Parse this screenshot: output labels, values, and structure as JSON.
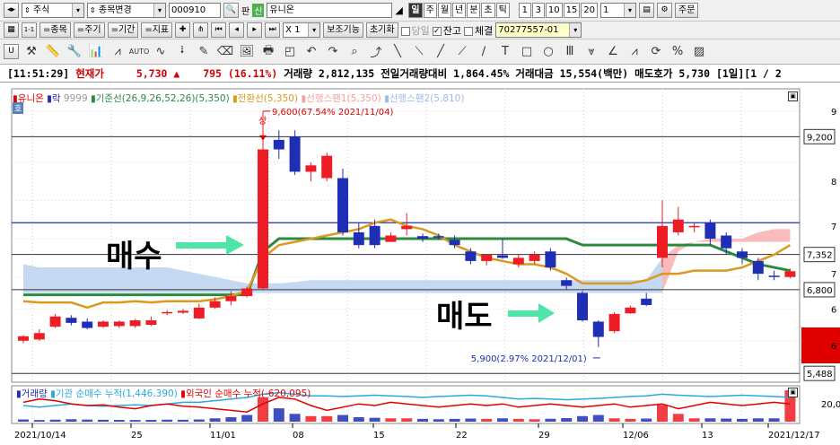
{
  "toolbar1": {
    "market": "주식",
    "change_label": "종목변경",
    "code": "000910",
    "pan": "판",
    "sin": "신",
    "name": "유니온",
    "periods": [
      "일",
      "주",
      "월",
      "년",
      "분",
      "초",
      "틱"
    ],
    "intervals": [
      "1",
      "3",
      "10",
      "15",
      "20"
    ],
    "interval_value": "1",
    "order_label": "주문"
  },
  "toolbar2": {
    "item_btn": "=종목",
    "cycle_btn": "=주기",
    "period_btn": "=기간",
    "indicator_btn": "=지표",
    "zoom": "X 1",
    "aux_btn": "보조기능",
    "reset_btn": "초기화",
    "today": "당일",
    "balance": "잔고",
    "trade": "체결",
    "account": "70277557-01"
  },
  "status": {
    "time": "[11:51:29]",
    "label": "현재가",
    "price": "5,730",
    "arrow": "▲",
    "change": "795",
    "change_pct": "(16.11%)",
    "volume_text": "거래량 2,812,135",
    "ratio_text": "전일거래량대비 1,864.45%",
    "amount_text": "거래대금 15,554(백만)",
    "ask_text": "매도호가 5,730",
    "page_text": "[1일][1 / 2"
  },
  "colors": {
    "up": "#ee1c25",
    "down": "#1f2fb5",
    "base": "#2b8a3e",
    "conv": "#d99a1e",
    "cloud": "#bcd2f0",
    "cloud_red": "#f8b4b4"
  },
  "main_legend": {
    "hoga": "호",
    "name": "유니온",
    "rak": "락",
    "rak2": "9999",
    "base_line": "기준선(26,9,26,52,26)(5,350)",
    "conv_line": "전환선(5,350)",
    "span1": "선행스팬1(5,350)",
    "span2": "선행스팬2(5,810)"
  },
  "annotations": {
    "high": "9,600(67.54% 2021/11/04)",
    "low": "5,900(2.97% 2021/12/01)",
    "sang": "상",
    "buy": "매수",
    "sell": "매도"
  },
  "y_labels": {
    "p9200": "9,200",
    "p7352": "7,352",
    "p6800": "6,800",
    "p5488": "5,488"
  },
  "y_ticks": [
    "9",
    "8",
    "7",
    "7",
    "6",
    "6"
  ],
  "sub_legend": {
    "vol": "거래량",
    "inst": "기관 순매수 누적(1,446,390)",
    "foreign": "외국인 순매수 누적(-620,095)",
    "right_label": "20,0"
  },
  "x_labels": [
    "2021/10/14",
    "25",
    "11/01",
    "08",
    "15",
    "22",
    "29",
    "12/06",
    "13",
    "2021/12/17"
  ],
  "chart_data": {
    "type": "candlestick",
    "price_ylim": [
      5350,
      9950
    ],
    "candles": [
      {
        "o": 6000,
        "h": 6090,
        "l": 5960,
        "c": 6070
      },
      {
        "o": 6020,
        "h": 6180,
        "l": 6000,
        "c": 6120
      },
      {
        "o": 6220,
        "h": 6420,
        "l": 6200,
        "c": 6380
      },
      {
        "o": 6360,
        "h": 6400,
        "l": 6240,
        "c": 6280
      },
      {
        "o": 6300,
        "h": 6350,
        "l": 6180,
        "c": 6200
      },
      {
        "o": 6220,
        "h": 6320,
        "l": 6200,
        "c": 6300
      },
      {
        "o": 6230,
        "h": 6320,
        "l": 6200,
        "c": 6300
      },
      {
        "o": 6230,
        "h": 6340,
        "l": 6200,
        "c": 6320
      },
      {
        "o": 6250,
        "h": 6380,
        "l": 6230,
        "c": 6320
      },
      {
        "o": 6430,
        "h": 6480,
        "l": 6400,
        "c": 6450
      },
      {
        "o": 6440,
        "h": 6500,
        "l": 6420,
        "c": 6470
      },
      {
        "o": 6350,
        "h": 6580,
        "l": 6340,
        "c": 6520
      },
      {
        "o": 6520,
        "h": 6680,
        "l": 6500,
        "c": 6620
      },
      {
        "o": 6620,
        "h": 6780,
        "l": 6560,
        "c": 6700
      },
      {
        "o": 6700,
        "h": 6850,
        "l": 6680,
        "c": 6820
      },
      {
        "o": 6820,
        "h": 9600,
        "l": 6800,
        "c": 9000
      },
      {
        "o": 9150,
        "h": 9300,
        "l": 8850,
        "c": 9000
      },
      {
        "o": 9200,
        "h": 9300,
        "l": 8600,
        "c": 8650
      },
      {
        "o": 8650,
        "h": 8800,
        "l": 8500,
        "c": 8750
      },
      {
        "o": 8550,
        "h": 8950,
        "l": 8500,
        "c": 8900
      },
      {
        "o": 8550,
        "h": 8700,
        "l": 7650,
        "c": 7700
      },
      {
        "o": 7700,
        "h": 7850,
        "l": 7450,
        "c": 7500
      },
      {
        "o": 7800,
        "h": 7900,
        "l": 7450,
        "c": 7500
      },
      {
        "o": 7550,
        "h": 7700,
        "l": 7550,
        "c": 7650
      },
      {
        "o": 7750,
        "h": 8000,
        "l": 7650,
        "c": 7800
      },
      {
        "o": 7640,
        "h": 7680,
        "l": 7550,
        "c": 7600
      },
      {
        "o": 7640,
        "h": 7680,
        "l": 7580,
        "c": 7620
      },
      {
        "o": 7580,
        "h": 7650,
        "l": 7450,
        "c": 7500
      },
      {
        "o": 7400,
        "h": 7450,
        "l": 7200,
        "c": 7250
      },
      {
        "o": 7250,
        "h": 7350,
        "l": 7180,
        "c": 7350
      },
      {
        "o": 7340,
        "h": 7600,
        "l": 7280,
        "c": 7300
      },
      {
        "o": 7200,
        "h": 7350,
        "l": 7150,
        "c": 7300
      },
      {
        "o": 7250,
        "h": 7400,
        "l": 7200,
        "c": 7350
      },
      {
        "o": 7400,
        "h": 7450,
        "l": 7100,
        "c": 7150
      },
      {
        "o": 6950,
        "h": 6990,
        "l": 6800,
        "c": 6860
      },
      {
        "o": 6750,
        "h": 6780,
        "l": 6300,
        "c": 6320
      },
      {
        "o": 6300,
        "h": 6320,
        "l": 5900,
        "c": 6060
      },
      {
        "o": 6150,
        "h": 6450,
        "l": 6120,
        "c": 6420
      },
      {
        "o": 6430,
        "h": 6550,
        "l": 6420,
        "c": 6520
      },
      {
        "o": 6660,
        "h": 6750,
        "l": 6540,
        "c": 6560
      },
      {
        "o": 7300,
        "h": 8200,
        "l": 7150,
        "c": 7800
      },
      {
        "o": 7700,
        "h": 8100,
        "l": 7650,
        "c": 7900
      },
      {
        "o": 7800,
        "h": 7850,
        "l": 7700,
        "c": 7800
      },
      {
        "o": 7850,
        "h": 7900,
        "l": 7500,
        "c": 7600
      },
      {
        "o": 7650,
        "h": 7700,
        "l": 7350,
        "c": 7450
      },
      {
        "o": 7400,
        "h": 7450,
        "l": 7200,
        "c": 7300
      },
      {
        "o": 7250,
        "h": 7300,
        "l": 6950,
        "c": 7050
      },
      {
        "o": 7020,
        "h": 7100,
        "l": 6950,
        "c": 7000
      },
      {
        "o": 7000,
        "h": 7130,
        "l": 6980,
        "c": 7090
      }
    ],
    "base_line": [
      6720,
      6720,
      6720,
      6720,
      6720,
      6720,
      6720,
      6720,
      6720,
      6720,
      6720,
      6720,
      6720,
      6720,
      6720,
      7400,
      7600,
      7600,
      7600,
      7600,
      7600,
      7600,
      7600,
      7600,
      7600,
      7600,
      7600,
      7600,
      7600,
      7600,
      7600,
      7600,
      7600,
      7600,
      7600,
      7500,
      7500,
      7500,
      7500,
      7500,
      7500,
      7500,
      7500,
      7500,
      7400,
      7300,
      7200,
      7150,
      7100
    ],
    "conv_line": [
      6620,
      6600,
      6600,
      6600,
      6520,
      6600,
      6600,
      6620,
      6600,
      6620,
      6620,
      6620,
      6650,
      6700,
      6780,
      7300,
      7500,
      7550,
      7600,
      7650,
      7700,
      7750,
      7850,
      7900,
      7800,
      7750,
      7650,
      7500,
      7400,
      7300,
      7250,
      7200,
      7200,
      7150,
      7050,
      6900,
      6900,
      6900,
      6900,
      6950,
      7050,
      7050,
      7100,
      7100,
      7100,
      7150,
      7250,
      7350,
      7500
    ],
    "span1": [
      7200,
      7150,
      7150,
      7150,
      7150,
      7150,
      7150,
      7150,
      7150,
      7150,
      7100,
      7050,
      7000,
      6950,
      6900,
      6900,
      6900,
      6920,
      6950,
      6950,
      6950,
      6950,
      6950,
      6950,
      6950,
      6950,
      6950,
      6950,
      6950,
      6950,
      6950,
      6950,
      6950,
      6950,
      6950,
      6950,
      6950,
      6950,
      6950,
      6950,
      7300,
      7500,
      7550,
      7600,
      7600,
      7600,
      7700,
      7750,
      7750
    ],
    "span2": [
      6750,
      6750,
      6750,
      6750,
      6750,
      6750,
      6750,
      6750,
      6750,
      6750,
      6750,
      6750,
      6750,
      6750,
      6750,
      6750,
      6750,
      6750,
      6750,
      6750,
      6750,
      6750,
      6750,
      6750,
      6750,
      6750,
      6750,
      6750,
      6750,
      6750,
      6750,
      6750,
      6750,
      6750,
      6750,
      6750,
      6750,
      6750,
      6750,
      6750,
      6750,
      7400,
      7550,
      7550,
      7550,
      7550,
      7550,
      7550,
      7550
    ],
    "volume": [
      200,
      150,
      180,
      220,
      190,
      170,
      160,
      150,
      160,
      180,
      170,
      200,
      300,
      400,
      600,
      2200,
      1200,
      700,
      500,
      500,
      600,
      400,
      350,
      300,
      300,
      250,
      220,
      250,
      280,
      250,
      300,
      250,
      220,
      260,
      320,
      500,
      600,
      300,
      250,
      280,
      1500,
      700,
      300,
      300,
      280,
      250,
      300,
      300,
      2812
    ],
    "inst_cum": [
      0.5,
      0.45,
      0.5,
      0.55,
      0.5,
      0.48,
      0.5,
      0.52,
      0.5,
      0.55,
      0.6,
      0.6,
      0.65,
      0.7,
      0.75,
      0.85,
      0.9,
      0.85,
      0.8,
      0.8,
      0.78,
      0.8,
      0.82,
      0.8,
      0.78,
      0.75,
      0.78,
      0.8,
      0.82,
      0.8,
      0.75,
      0.7,
      0.72,
      0.7,
      0.68,
      0.7,
      0.72,
      0.75,
      0.78,
      0.8,
      0.85,
      0.82,
      0.8,
      0.78,
      0.8,
      0.82,
      0.8,
      0.78,
      0.75
    ],
    "foreign_cum": [
      0.6,
      0.7,
      0.65,
      0.55,
      0.5,
      0.52,
      0.45,
      0.4,
      0.5,
      0.55,
      0.48,
      0.45,
      0.4,
      0.35,
      0.3,
      0.55,
      0.75,
      0.7,
      0.5,
      0.35,
      0.45,
      0.55,
      0.5,
      0.6,
      0.55,
      0.5,
      0.45,
      0.5,
      0.55,
      0.5,
      0.55,
      0.45,
      0.5,
      0.55,
      0.5,
      0.45,
      0.5,
      0.55,
      0.45,
      0.5,
      0.55,
      0.4,
      0.5,
      0.6,
      0.55,
      0.5,
      0.55,
      0.6,
      0.55
    ]
  }
}
